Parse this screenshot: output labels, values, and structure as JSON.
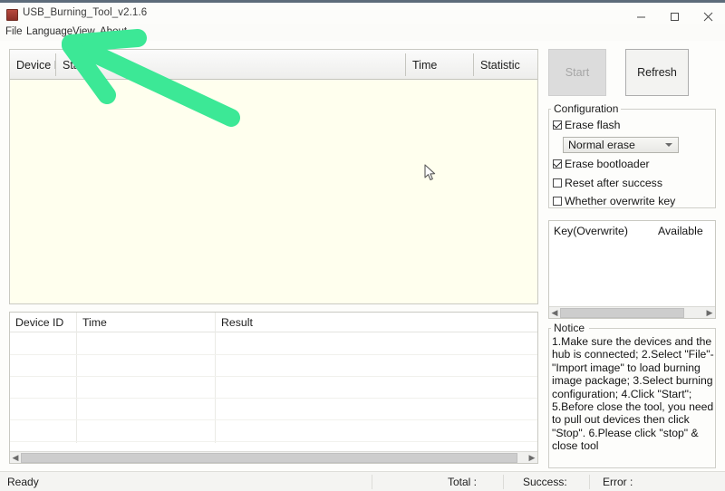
{
  "window": {
    "title": "USB_Burning_Tool_v2.1.6",
    "icon": "app-icon",
    "controls": {
      "minimize": "minimize-icon",
      "maximize": "maximize-icon",
      "close": "close-icon"
    }
  },
  "menubar": {
    "items": [
      {
        "label": "File"
      },
      {
        "label": "Language"
      },
      {
        "label": "View"
      },
      {
        "label": "About"
      }
    ]
  },
  "device_list": {
    "columns": [
      "Device ID",
      "Status",
      "Time",
      "Statistic"
    ],
    "rows": [],
    "background_color": "#ffffee"
  },
  "actions": {
    "start_label": "Start",
    "start_enabled": false,
    "refresh_label": "Refresh"
  },
  "configuration": {
    "title": "Configuration",
    "options": [
      {
        "label": "Erase flash",
        "checked": true
      },
      {
        "label": "Erase bootloader",
        "checked": true
      },
      {
        "label": "Reset after success",
        "checked": false
      },
      {
        "label": "Whether overwrite key",
        "checked": false
      }
    ],
    "erase_mode": {
      "value": "Normal erase"
    }
  },
  "key_list": {
    "columns": [
      "Key(Overwrite)",
      "Available"
    ],
    "rows": []
  },
  "notice": {
    "title": "Notice",
    "text": "1.Make sure the devices and the hub is connected;\n2.Select \"File\"-\"Import image\" to load burning image package;\n3.Select burning configuration;\n4.Click \"Start\";\n5.Before close the tool, you need to pull out devices then click \"Stop\".\n6.Please click \"stop\" & close tool"
  },
  "result_list": {
    "columns": [
      "Device ID",
      "Time",
      "Result"
    ],
    "rows": []
  },
  "statusbar": {
    "state": "Ready",
    "total_label": "Total :",
    "success_label": "Success:",
    "error_label": "Error :"
  },
  "annotation": {
    "type": "arrow",
    "color": "#3ce896",
    "points_to": "View"
  }
}
